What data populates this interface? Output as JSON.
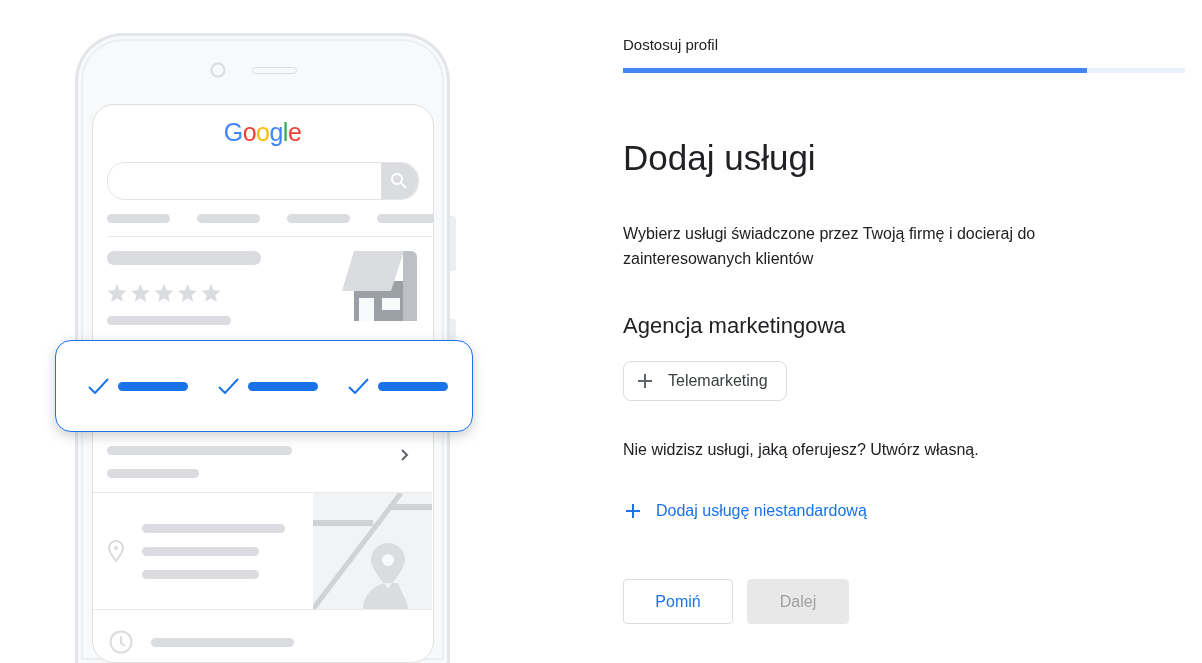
{
  "illustration": {
    "logo": "Google"
  },
  "progress": {
    "label": "Dostosuj profil",
    "level": 0.825
  },
  "title": "Dodaj usługi",
  "description": "Wybierz usługi świadczone przez Twoją firmę i docieraj do zainteresowanych klientów",
  "category": "Agencja marketingowa",
  "suggestions": [
    {
      "label": "Telemarketing"
    }
  ],
  "prompt": "Nie widzisz usługi, jaką oferujesz? Utwórz własną.",
  "custom_link": {
    "label": "Dodaj usługę niestandardową"
  },
  "buttons": [
    {
      "label": "Pomiń",
      "disabled": false
    },
    {
      "label": "Dalej",
      "disabled": true
    }
  ]
}
